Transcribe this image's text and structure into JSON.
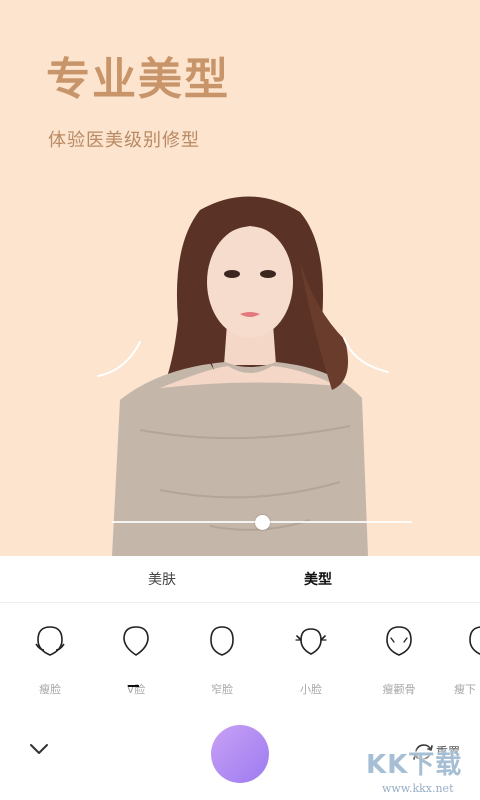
{
  "hero": {
    "title": "专业美型",
    "subtitle": "体验医美级别修型",
    "slider_value": 0.5
  },
  "tabs": [
    {
      "label": "美肤",
      "active": false
    },
    {
      "label": "美型",
      "active": true
    }
  ],
  "tools": [
    {
      "label": "瘦脸",
      "icon": "thin-face-icon"
    },
    {
      "label": "V脸",
      "icon": "v-face-icon",
      "selected": true
    },
    {
      "label": "窄脸",
      "icon": "narrow-face-icon"
    },
    {
      "label": "小脸",
      "icon": "small-face-icon"
    },
    {
      "label": "瘦颧骨",
      "icon": "cheekbone-icon"
    },
    {
      "label": "瘦下",
      "icon": "thin-jaw-icon"
    }
  ],
  "bottom_bar": {
    "collapse_icon": "chevron-down-icon",
    "reset_label": "重置",
    "reset_icon": "reset-icon"
  },
  "watermark": {
    "brand": "KK下载",
    "url": "www.kkx.net"
  },
  "colors": {
    "hero_bg": "#fce4cf",
    "title": "#c8956a",
    "accent_gradient_start": "#c9a1f5",
    "accent_gradient_end": "#9c7bf0"
  }
}
